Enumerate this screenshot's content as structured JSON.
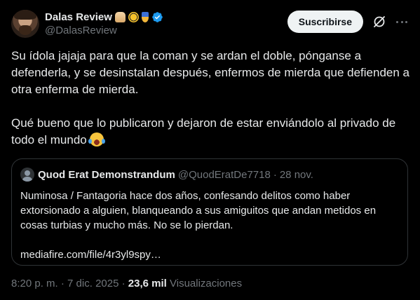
{
  "author": {
    "display_name": "Dalas Review",
    "badges": [
      "bread-emoji",
      "bee-emoji",
      "medal-emoji"
    ],
    "verified": true,
    "handle": "@DalasReview"
  },
  "actions": {
    "subscribe_label": "Suscribirse",
    "grok_icon": "grok-icon",
    "more_icon": "more-icon"
  },
  "tweet": {
    "paragraph1": "Su ídola jajaja para que la coman y se ardan el doble, pónganse a defenderla, y se desinstalan después, enfermos de mierda que defienden a otra enferma de mierda.",
    "paragraph2": "Qué bueno que lo publicaron y dejaron de estar enviándolo al privado de todo el mundo",
    "emoji": "face-with-tears-of-joy"
  },
  "quote": {
    "display_name": "Quod Erat Demonstrandum",
    "handle": "@QuodEratDe7718",
    "separator": "·",
    "date": "28 nov.",
    "body": "Numinosa / Fantagoria hace dos años, confesando delitos como haber extorsionado a alguien, blanqueando a sus amiguitos que andan metidos en cosas turbias y mucho más. No se lo pierdan.",
    "link": "mediafire.com/file/4r3yl9spy…"
  },
  "meta": {
    "time": "8:20 p. m.",
    "sep1": "·",
    "date": "7 dic. 2025",
    "sep2": "·",
    "views_count": "23,6 mil",
    "views_label": "Visualizaciones"
  },
  "colors": {
    "background": "#000000",
    "text": "#e7e9ea",
    "secondary": "#71767b",
    "border": "#2f3336",
    "verified": "#1d9bf0",
    "button_bg": "#eff3f4"
  }
}
